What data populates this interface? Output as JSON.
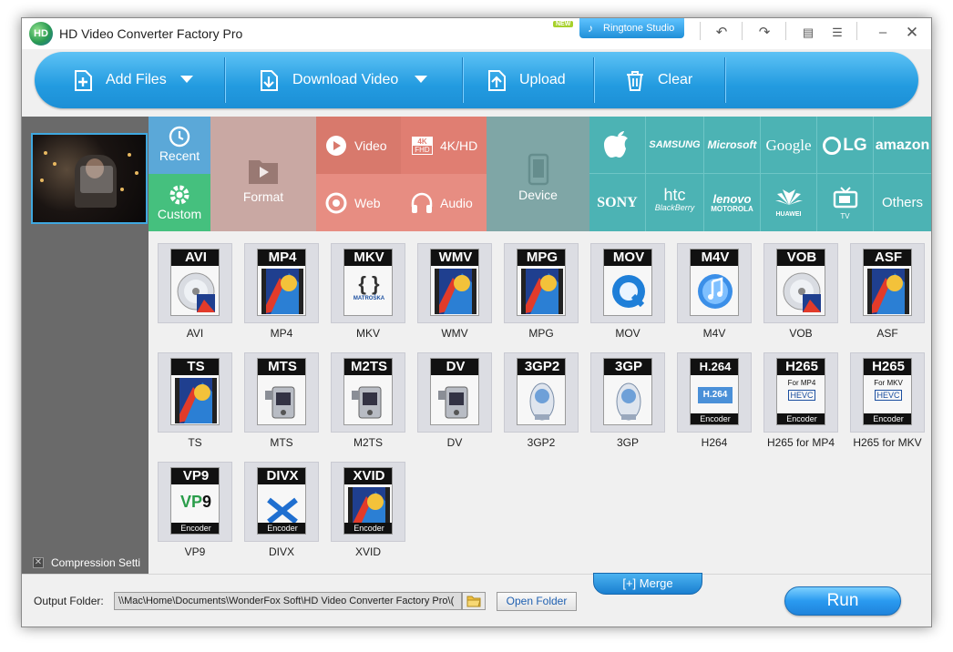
{
  "window": {
    "title": "HD Video Converter Factory Pro",
    "new_badge": "NEW",
    "ringtone_studio": "Ringtone Studio"
  },
  "titlebar_icons": [
    "undo-icon",
    "redo-icon",
    "chat-icon",
    "list-icon",
    "minimize-icon",
    "close-icon"
  ],
  "toolbar": {
    "add_files": "Add Files",
    "download_video": "Download Video",
    "upload": "Upload",
    "clear": "Clear"
  },
  "categories": {
    "recent": "Recent",
    "custom": "Custom",
    "format": "Format",
    "video": "Video",
    "fourk": "4K/HD",
    "web": "Web",
    "audio": "Audio",
    "device": "Device",
    "others": "Others",
    "fourk_badge_top": "4K",
    "fourk_badge_bottom": "FHD"
  },
  "brands": {
    "samsung": "SAMSUNG",
    "microsoft": "Microsoft",
    "google": "Google",
    "lg": "LG",
    "amazon": "amazon",
    "sony": "SONY",
    "htc": "htc",
    "htc_sub": "BlackBerry",
    "lenovo": "lenovo",
    "lenovo_sub": "MOTOROLA",
    "huawei": "HUAWEI",
    "tv": "TV"
  },
  "formats": [
    {
      "name": "AVI",
      "label": "AVI",
      "art": "disc"
    },
    {
      "name": "MP4",
      "label": "MP4",
      "art": "film"
    },
    {
      "name": "MKV",
      "label": "MKV",
      "art": "matroska",
      "sub": "MATROŠKA"
    },
    {
      "name": "WMV",
      "label": "WMV",
      "art": "film"
    },
    {
      "name": "MPG",
      "label": "MPG",
      "art": "film"
    },
    {
      "name": "MOV",
      "label": "MOV",
      "art": "quicktime"
    },
    {
      "name": "M4V",
      "label": "M4V",
      "art": "itunes"
    },
    {
      "name": "VOB",
      "label": "VOB",
      "art": "disc"
    },
    {
      "name": "ASF",
      "label": "ASF",
      "art": "film"
    },
    {
      "name": "TS",
      "label": "TS",
      "art": "film"
    },
    {
      "name": "MTS",
      "label": "MTS",
      "art": "camcorder"
    },
    {
      "name": "M2TS",
      "label": "M2TS",
      "art": "camcorder"
    },
    {
      "name": "DV",
      "label": "DV",
      "art": "camcorder"
    },
    {
      "name": "3GP2",
      "label": "3GP2",
      "art": "phone"
    },
    {
      "name": "3GP",
      "label": "3GP",
      "art": "phone"
    },
    {
      "name": "H264",
      "label": "H.264",
      "art": "h264",
      "sub": "H.264",
      "enc": "Encoder"
    },
    {
      "name": "H265 for MP4",
      "label": "H265",
      "art": "hevc",
      "sub": "For MP4",
      "sub2": "HEVC",
      "enc": "Encoder"
    },
    {
      "name": "H265 for MKV",
      "label": "H265",
      "art": "hevc",
      "sub": "For MKV",
      "sub2": "HEVC",
      "enc": "Encoder"
    },
    {
      "name": "VP9",
      "label": "VP9",
      "art": "vp9",
      "sub": "VP9",
      "enc": "Encoder"
    },
    {
      "name": "DIVX",
      "label": "DIVX",
      "art": "divx",
      "enc": "Encoder"
    },
    {
      "name": "XVID",
      "label": "XVID",
      "art": "film",
      "enc": "Encoder"
    }
  ],
  "left": {
    "compression_settings": "Compression Setti"
  },
  "bottom": {
    "output_folder_label": "Output Folder:",
    "output_path": "\\\\Mac\\Home\\Documents\\WonderFox Soft\\HD Video Converter Factory Pro\\(",
    "open_folder": "Open Folder",
    "merge": "Merge",
    "merge_icon": "[+]",
    "run": "Run"
  },
  "colors": {
    "accent": "#239be0",
    "recent": "#5ba8d8",
    "custom": "#45c07e",
    "format": "#c9a8a3",
    "video": "#d8796c",
    "web": "#e78d82",
    "device": "#7fa6a6",
    "brands": "#4cb3b4"
  }
}
